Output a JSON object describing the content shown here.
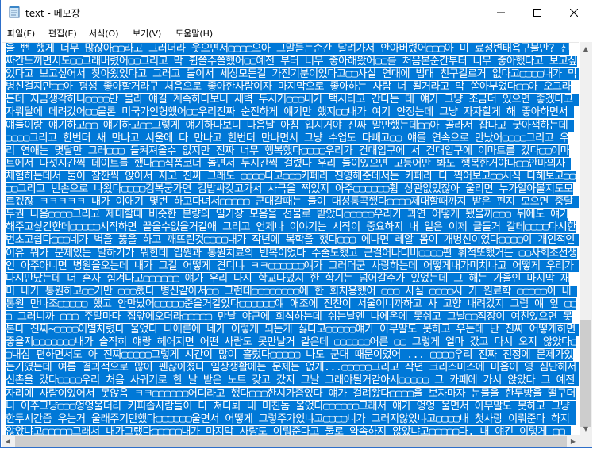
{
  "window": {
    "title": "text - 메모장",
    "buttons": {
      "minimize": "—",
      "maximize": "☐",
      "close": "✕"
    }
  },
  "menu": {
    "items": [
      {
        "id": "file",
        "label": "파일(F)"
      },
      {
        "id": "edit",
        "label": "편집(E)"
      },
      {
        "id": "format",
        "label": "서식(O)"
      },
      {
        "id": "view",
        "label": "보기(V)"
      },
      {
        "id": "help",
        "label": "도움말(H)"
      }
    ]
  },
  "editor": {
    "selected": true,
    "text": "을 뻔 했게 너무 많잖아▢▢라고 그러더라 웃으면서▢▢▢▢으아 그말듣는순간 달려가서 안아버렸어▢▢▢아 미 료정변태욕구불만? 진짜간느끼면서도▢▢그래버렸어▢▢그리고 막 휩쓸수쓸했어▢▢예전 부터 너무 좋아해왔어▢▢를 처음본순간부터 너무 좋아했다고 보고싶었다고 보고싶어서 찾아왔었다고 그러고 둘이서 세상모든걸 가진기분이었다고▢▢사실 연대에 법대 친구길르거 없다고▢▢▢▢내가 막 병신걸지만▢▢아 평생 좋아할거라구 처음으로 좋아한사람이자 마지막으로 좋아하는 사람 너 될거라고 막 쏟아부었다▢▢아 오그라든데 지금생각하니▢▢▢▢만 물라 얘길 계속하다보니 새벽 두시거▢▢▢내가 택시타고 간다는 데 얘가 그냥 조금더 있으면 좋겠다고 자뤄달에 데려갔어▢▢물론 미국가인형했어▢▢우리진짜 순진하게 얘기만 했지▢▢내가 여기 안정는데 그냥 자자할게 해 좋아하면서 얘들이랑 얘기하고▢▢ 얘기하고▢▢그렇게 얘기하다보니 다음날 아침 입시거야 진짜 말만했는데▢▢아 골라서 잡다고 굿아잭하는데 ▢▢▢▢그리고 한번더 새 만나고 서울에 다 만나고 한번더 만나면서 그냥 수업도 다빼고▢▢ 얘를 연속으로 만났어▢▢▢▢그리고 우리 연애는 몇달만 그러▢▢▢ 들켜져올수 없지만 진짜 너무 행복했다▢▢▢▢우리가 건대입구에 서 건대입구에 이마트를 갔다▢▢이마트에서 다섯시간씩 데이트를 했다▢▢식품코너 돌면서 두시간씩 걸렸다 우리 둘이있으면 고등어만 봐도 행복한거야나▢▢안마의자 체험하는데서 둘이 잠깐씩 앉아서 자고 진짜 그래도 ▢▢▢▢다고▢▢▢카페라 진영해준데서는 카페라 다 찍어보고▢▢시식 다해보고▢▢▢▢그리고 빈손으로 나왔다▢▢▢▢검복궁가면 김밥싸갖고가서 사극을 찍었지 아주▢▢▢▢▢▢휩 상관없었잖아 울리면 누가알아볼지도모르겠잖 ㅋㅋㅋㅋㅋ 내가 이애기 몇번 하고다녀서▢▢▢▢▢ 군대갈때는 둘이 대성통곡했다▢▢▢▢제대할때까지 받은 편지 모으면 중달 두권 나옴▢▢▢▢그리고 제대할때 비슷한 분량의 일기장 모음을 선물로 받았다▢▢▢▢▢우리가 과연 어떻게 됐을까▢▢▢ 뒤에도 얘기해주고싶긴한데▢▢▢▢▢시작하면 끝을수없을거같애 그리고 언제나 이야기는 시작이 중요하지 내 일은 이제 글들거 갈테▢▢▢▢다시한번초고쉽다▢▢▢네가 벽을 뚫을 하고 깨뜨린것▢▢▢▢내가 작년에 복학을 했다▢▢▢ 에나면 레알 몸이 개병신이었다▢▢▢▢이 개인적인 이유 뭐가 문제있는 말하기가 뭐한데 입원과 통원치료의 반복이었다 수술도했고 근걸어나디비▢▢▢▢편 휘적또했거든 ▢▢사회조선생인 아주아니면 병원을오는데 내가 그걸 어떻게 견디냐 ㅋㅋ▢▢▢▢▢▢얘가 그러더군 사랑하는데 어떻게내가미치나고 어떻게 우리가 다시만났는데 너 혼자 힘겨나고▢▢▢▢▢▢ 얘가 우리 다시 학교다녔지 한 학기는 넘어갈수가 있었는데 그 해는 가을인 마지막 재미 내가 통원하고▢▢기만 ▢▢▢했다 병신같아서▢▢ 그런데▢▢▢▢▢▢▢▢에 한 회치용했어 ▢▢▢ 사실 ▢▢▢▢시 가 원료학 ▢▢▢▢▢이 내 통원 만나조▢▢▢▢▢ 했고 안만났어▢▢▢▢▢준을거같았다▢▢▢▢▢▢얘 애조에 진찬이 서울이니까하고 사 고향 내려갔지 그럼 얘 앞 ▢▢▢ 그러니까 ▢▢▢ 주말마다 집앞에오더라▢▢▢▢▢ 만날 야근에 회식하는데 쉬는날엔 나에온에 못쉬고 그날▢▢직장이 여친있으면 못본다 진짜~▢▢▢▢이별차렸다 울었다 나애른에 네가 이렇게 되는게 싫다고▢▢▢▢▢얘가 아무말도 못하고 우는데 난 진짜 어떻게하면 좋을지▢▢▢▢▢▢▢내가 솔직히 얘랑 헤어지면 어떤 사람도 못만날거 같은데 ▢▢▢▢▢▢어른 ▢▢ 그렇게 얼마 갔고 다시 오지 않았다▢▢내심 편하면서도 아 진짜▢▢▢▢▢그렇게 시간이 많이 흘렀다▢▢▢▢▢ 나도 군대 때문이었어 ... ▢▢▢▢우리 진짜 진정에 문제가있는거였는데 여름 결과적으로 많이 펜찮아졌다 일상생활에는 문제는 없게...▢▢▢▢▢그리고 작년 크리스마스에 마음이 영 심난해서 신촌을 갔다▢▢▢▢우리 처음 사귀기로 한 날 받은 노트 갖고 갔지 그날 그래야될거같아서▢▢▢▢▢ 그 카페에 가서 앉았다 그 예전 자리에 사람이있어서 못앉음 ㅋㅋ▢▢▢▢▢▢어디라고 했다▢▢▢한시가즘있다 얘가 걸려왔다▢▢▢▢을 보자마자 눈물을 한두방울 떨구더니 아주그냥▢▢▢엉엉울더라 커피솝사람들이 다 쳐다봐 내 미친놈 울었다▢▢▢▢▢▢그래서 얘가 엉엉 울면서 아무말도 못하고 그냥 한두시간즘 우는거 울래주기만했다▢▢▢▢▢▢울면서 어떻게 그렇주가있냐고▢▢▢▢니가 그러지않았냐고▢▢▢▢내 첫사랑 이뤄준다 하지 않았냐고▢▢▢▢▢그래서 내가그랬다▢▢▢▢▢내가 마지막 사랑도 이뤄준다고 둘로 약속하지 않았냐고▢▢▢▢▢다. 내 얘긴 이렇게 ▢▢ 요▢▢▢▢다를 읽어줘서 고맙다.▢수업 잘 들어라. 오늘 햇빛이 좋네.이것은 텍스트 파일입니다."
  },
  "scrollbars": {
    "up_arrow": "▲",
    "down_arrow": "▼",
    "left_arrow": "◀",
    "right_arrow": "▶"
  }
}
